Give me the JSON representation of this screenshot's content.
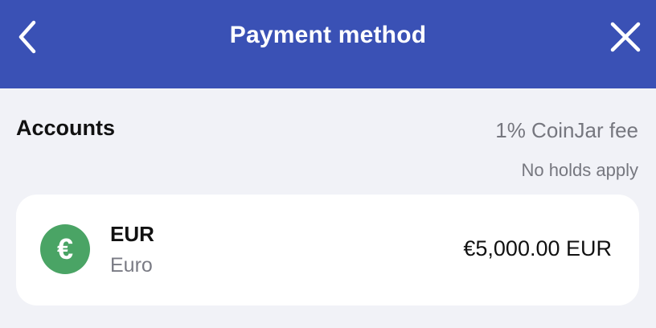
{
  "header": {
    "title": "Payment method",
    "back_icon": "chevron-left-icon",
    "close_icon": "close-icon",
    "background": "#3a51b5"
  },
  "accounts": {
    "section_title": "Accounts",
    "fee": "1% CoinJar fee",
    "holds": "No holds apply",
    "items": [
      {
        "code": "EUR",
        "name": "Euro",
        "balance": "€5,000.00 EUR",
        "icon": "euro-icon",
        "icon_symbol": "€",
        "icon_color": "#4aa465"
      }
    ]
  }
}
